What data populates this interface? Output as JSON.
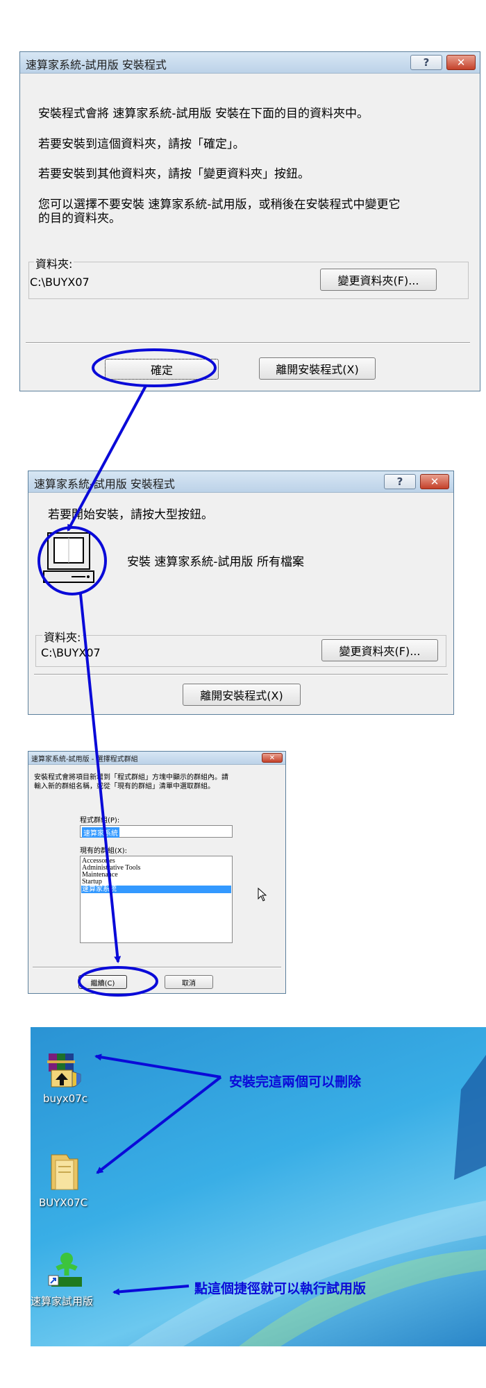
{
  "dialog1": {
    "title": "速算家系統-試用版 安裝程式",
    "help_label": "?",
    "close_label": "✕",
    "line1": "安裝程式會將 速算家系統-試用版 安裝在下面的目的資料夾中。",
    "line2": "若要安裝到這個資料夾，請按「確定」。",
    "line3": "若要安裝到其他資料夾，請按「變更資料夾」按鈕。",
    "line4a": "您可以選擇不要安裝 速算家系統-試用版，或稍後在安裝程式中變更它",
    "line4b": "的目的資料夾。",
    "folder_legend": "資料夾:",
    "folder_path": "C:\\BUYX07",
    "change_folder_label": "變更資料夾(F)...",
    "ok_label": "確定",
    "exit_label": "離開安裝程式(X)"
  },
  "dialog2": {
    "title": "速算家系統-試用版 安裝程式",
    "help_label": "?",
    "close_label": "✕",
    "instruction": "若要開始安裝，請按大型按鈕。",
    "install_label": "安裝 速算家系統-試用版 所有檔案",
    "folder_legend": "資料夾:",
    "folder_path": "C:\\BUYX07",
    "change_folder_label": "變更資料夾(F)...",
    "exit_label": "離開安裝程式(X)"
  },
  "dialog3": {
    "title": "速算家系統-試用版 - 選擇程式群組",
    "close_label": "✕",
    "desc1": "安裝程式會將項目新增到「程式群組」方塊中顯示的群組內。請",
    "desc2": "輸入新的群組名稱，或從「現有的群組」清單中選取群組。",
    "group_label": "程式群組(P):",
    "group_value": "速算家系統",
    "existing_label": "現有的群組(X):",
    "existing_groups": [
      "Accessories",
      "Administrative Tools",
      "Maintenance",
      "Startup",
      "速算家系統"
    ],
    "continue_label": "繼續(C)",
    "cancel_label": "取消"
  },
  "desktop": {
    "icons": [
      {
        "label": "buyx07c"
      },
      {
        "label": "BUYX07C"
      },
      {
        "label": "速算家試用版"
      }
    ],
    "annotation1": "安裝完這兩個可以刪除",
    "annotation2": "點這個捷徑就可以執行試用版"
  },
  "colors": {
    "annotation": "#0a0ad8",
    "selection": "#3399ff"
  }
}
